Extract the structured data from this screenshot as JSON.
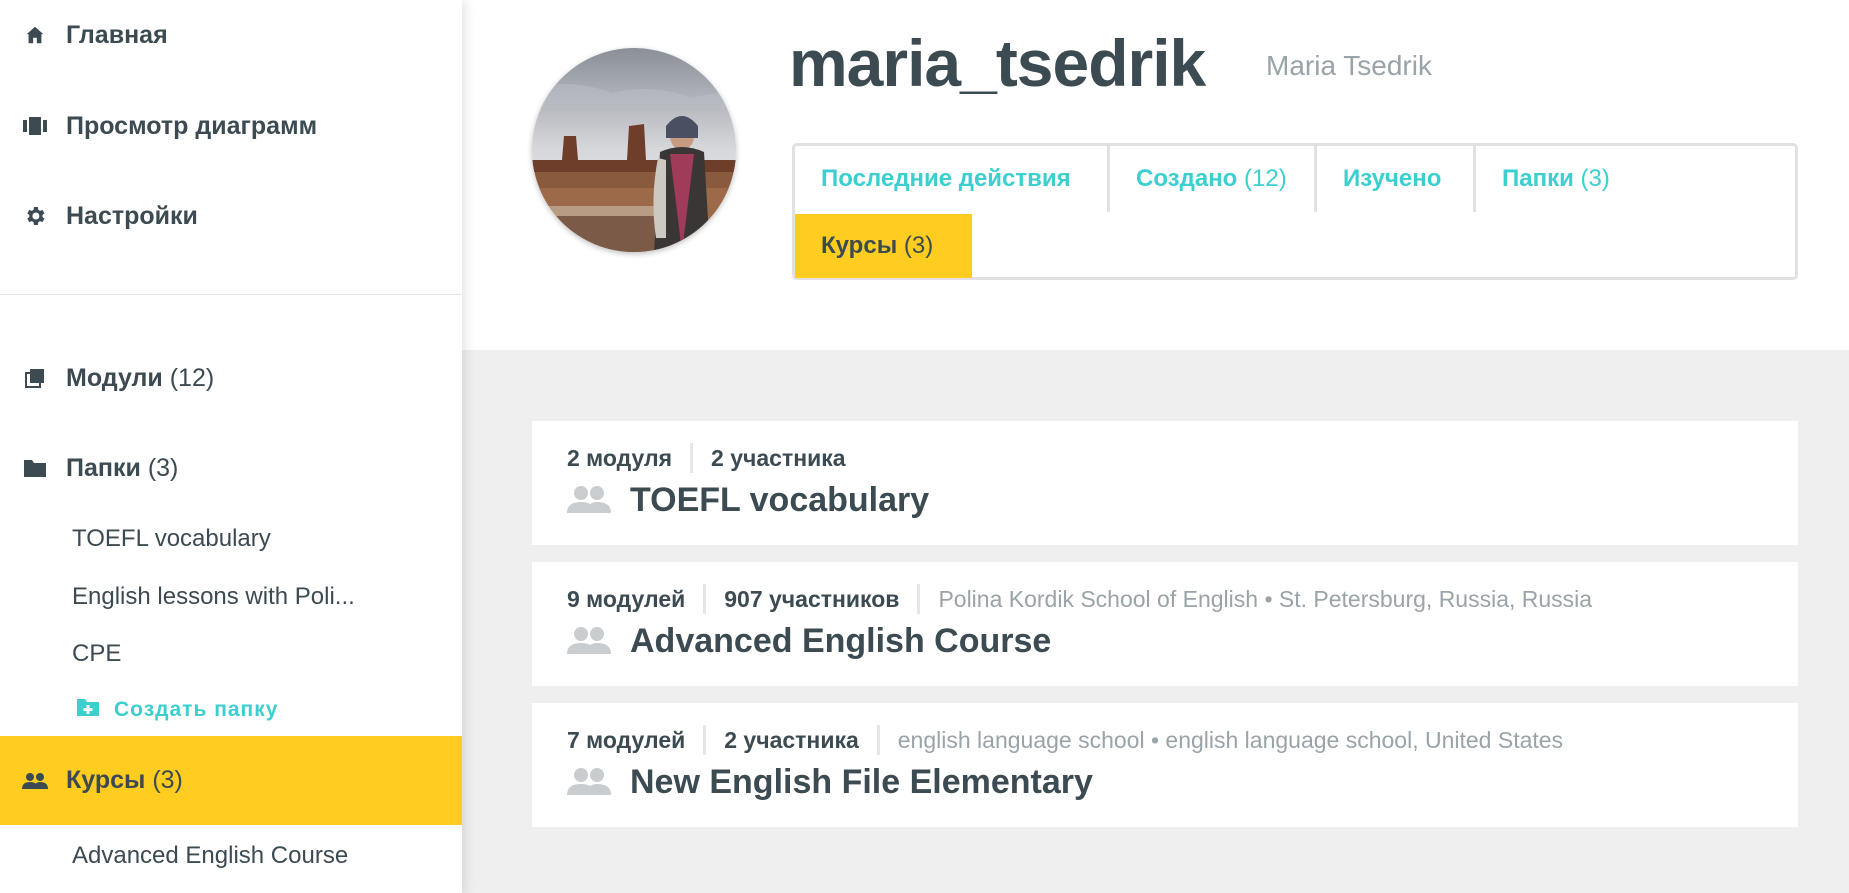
{
  "sidebar": {
    "nav": [
      {
        "label": "Главная",
        "icon": "home-icon"
      },
      {
        "label": "Просмотр диаграмм",
        "icon": "diagrams-icon"
      },
      {
        "label": "Настройки",
        "icon": "gear-icon"
      }
    ],
    "modules": {
      "label": "Модули",
      "count": "(12)"
    },
    "folders": {
      "label": "Папки",
      "count": "(3)"
    },
    "folder_items": [
      "TOEFL vocabulary",
      "English lessons with Poli...",
      "CPE"
    ],
    "create_folder": "Создать папку",
    "courses": {
      "label": "Курсы",
      "count": "(3)"
    },
    "course_items": [
      "Advanced English Course"
    ]
  },
  "profile": {
    "username": "maria_tsedrik",
    "real_name": "Maria Tsedrik"
  },
  "tabs": [
    {
      "label": "Последние действия",
      "count": ""
    },
    {
      "label": "Создано",
      "count": "(12)"
    },
    {
      "label": "Изучено",
      "count": ""
    },
    {
      "label": "Папки",
      "count": "(3)"
    },
    {
      "label": "Курсы",
      "count": "(3)"
    }
  ],
  "courses": [
    {
      "modules": "2 модуля",
      "members": "2 участника",
      "school": "",
      "title": "TOEFL vocabulary"
    },
    {
      "modules": "9 модулей",
      "members": "907 участников",
      "school": "Polina Kordik School of English • St. Petersburg, Russia, Russia",
      "title": "Advanced English Course"
    },
    {
      "modules": "7 модулей",
      "members": "2 участника",
      "school": "english language school • english language school, United States",
      "title": "New English File Elementary"
    }
  ],
  "colors": {
    "accent_yellow": "#ffcd1f",
    "link_teal": "#3ccfcf",
    "text_dark": "#3c4a52",
    "text_muted": "#9aa3a8"
  }
}
